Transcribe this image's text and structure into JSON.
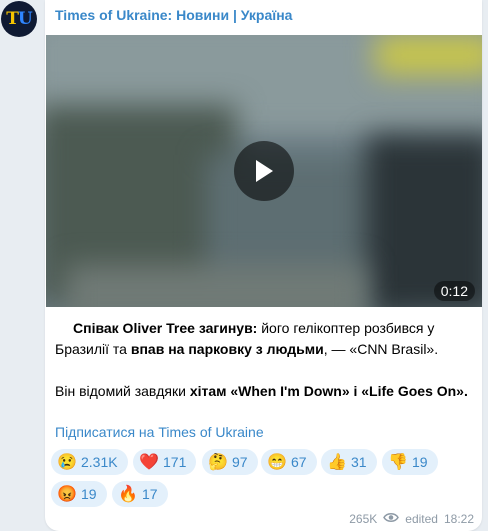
{
  "channel": {
    "avatar_text_1": "T",
    "avatar_text_2": "U",
    "name": "Times of Ukraine: Новини | Україна"
  },
  "video": {
    "duration": "0:12"
  },
  "message": {
    "line1_bold": "Співак Oliver Tree загинув:",
    "line1_rest": " його гелікоптер розбився у",
    "line2_start": "Бразилії та ",
    "line2_bold": "впав на парковку з людьми",
    "line2_rest": ", — «CNN Brasil».",
    "line3_start": "Він відомий завдяки ",
    "line3_bold": "хітам «When I'm Down» і «Life Goes On»",
    "line3_end": "."
  },
  "subscribe_link": "Підписатися на Times of Ukraine",
  "reactions": [
    {
      "emoji": "😢",
      "count": "2.31K"
    },
    {
      "emoji": "❤️",
      "count": "171"
    },
    {
      "emoji": "🤔",
      "count": "97"
    },
    {
      "emoji": "😁",
      "count": "67"
    },
    {
      "emoji": "👍",
      "count": "31"
    },
    {
      "emoji": "👎",
      "count": "19"
    },
    {
      "emoji": "😡",
      "count": "19"
    },
    {
      "emoji": "🔥",
      "count": "17"
    }
  ],
  "footer": {
    "views": "265K",
    "edited": "edited",
    "time": "18:22"
  },
  "colors": {
    "accent": "#3a88c9",
    "reaction_bg": "#e3f0fb",
    "chat_bg": "#e8edf2"
  }
}
